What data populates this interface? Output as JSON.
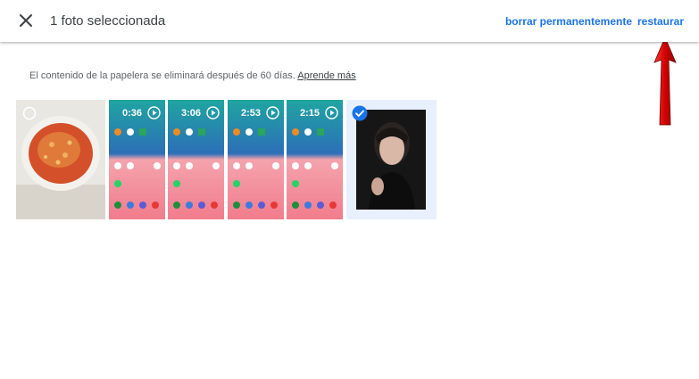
{
  "header": {
    "title": "1 foto seleccionada",
    "delete_label": "borrar permanentemente",
    "restore_label": "restaurar"
  },
  "info": {
    "text": "El contenido de la papelera se eliminará después de 60 días.",
    "link": "Aprende más"
  },
  "photos": [
    {
      "type": "photo",
      "subject": "soup bowl",
      "selected": false
    },
    {
      "type": "video",
      "duration": "0:36",
      "selected": false
    },
    {
      "type": "video",
      "duration": "3:06",
      "selected": false
    },
    {
      "type": "video",
      "duration": "2:53",
      "selected": false
    },
    {
      "type": "video",
      "duration": "2:15",
      "selected": false
    },
    {
      "type": "photo",
      "subject": "portrait",
      "selected": true
    }
  ],
  "colors": {
    "accent": "#1a73e8",
    "selection_bg": "#e8f0fe",
    "annotation_arrow": "#e0000e"
  }
}
